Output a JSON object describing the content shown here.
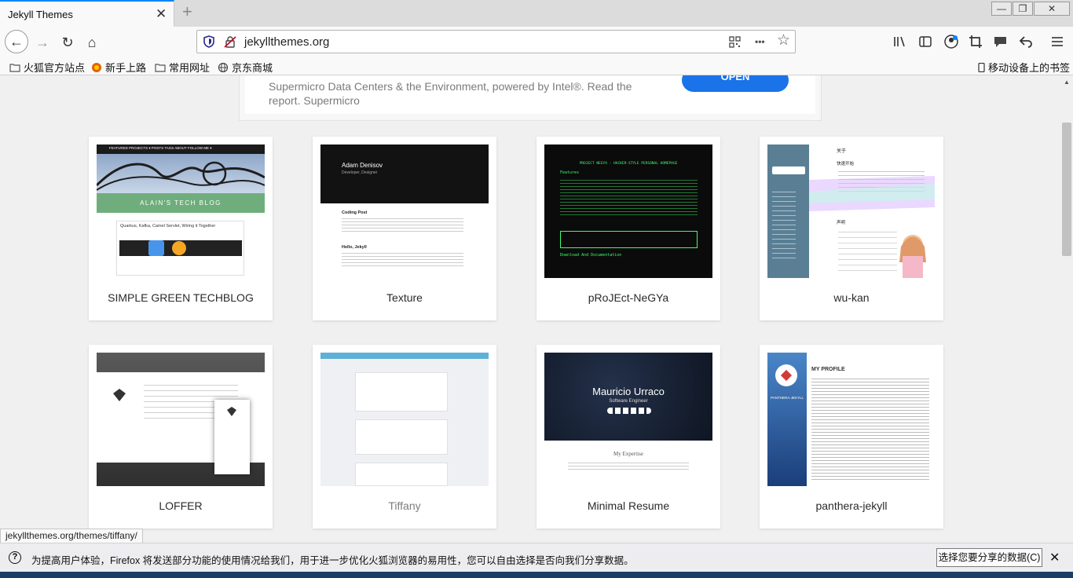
{
  "tab": {
    "title": "Jekyll Themes",
    "close": "✕",
    "new": "+"
  },
  "window": {
    "minimize": "—",
    "restore": "❐",
    "close": "✕"
  },
  "nav": {
    "back": "←",
    "forward": "→",
    "reload": "↻",
    "home": "⌂",
    "url": "jekyllthemes.org",
    "more": "•••",
    "star": "☆"
  },
  "bookmarks": {
    "items": [
      {
        "label": "火狐官方站点"
      },
      {
        "label": "新手上路"
      },
      {
        "label": "常用网址"
      },
      {
        "label": "京东商城"
      }
    ],
    "mobile": "移动设备上的书签"
  },
  "ad": {
    "text": "Supermicro Data Centers & the Environment, powered by Intel®. Read the report. Supermicro",
    "button": "OPEN"
  },
  "themes": [
    {
      "name": "SIMPLE GREEN TECHBLOG",
      "thumb": {
        "menu": "FEATURED PROJECTS ▾   POSTS   TAGS   ABOUT   FOLLOW ME ▾",
        "banner": "ALAIN'S TECH BLOG",
        "post": "Quarkus, Kafka, Camel Servlet, Wiring it Together"
      }
    },
    {
      "name": "Texture",
      "thumb": {
        "author": "Adam Denisov",
        "role": "Developer, Designer",
        "post1": "Coding Post",
        "post2": "Hello, Jekyll"
      }
    },
    {
      "name": "pRoJEct-NeGYa",
      "thumb": {
        "heading": "PROJECT NEGYA - HACKER-STYLE PERSONAL HOMEPAGE",
        "features": "Features",
        "doc": "Download And Documentation"
      }
    },
    {
      "name": "wu-kan",
      "thumb": {
        "about": "关于",
        "start": "快速开始",
        "stmt": "声明"
      }
    },
    {
      "name": "LOFFER",
      "thumb": {}
    },
    {
      "name": "Tiffany",
      "thumb": {}
    },
    {
      "name": "Minimal Resume",
      "thumb": {
        "person": "Mauricio Urraco",
        "role": "Software Engineer",
        "section": "My Expertise"
      }
    },
    {
      "name": "panthera-jekyll",
      "thumb": {
        "title": "MY PROFILE",
        "brand": "PANTHERA-JEKYLL"
      }
    }
  ],
  "status_url": "jekyllthemes.org/themes/tiffany/",
  "notice": {
    "text": "为提高用户体验，Firefox 将发送部分功能的使用情况给我们，用于进一步优化火狐浏览器的易用性，您可以自由选择是否向我们分享数据。",
    "button": "选择您要分享的数据(C)",
    "close": "✕"
  }
}
